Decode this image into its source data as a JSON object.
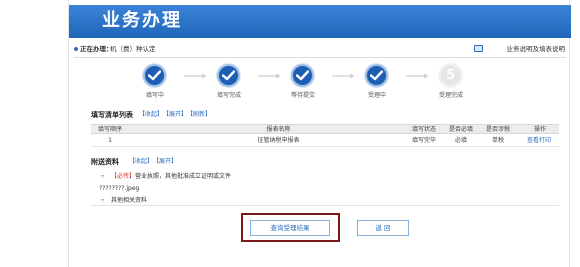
{
  "header": {
    "title": "业务办理"
  },
  "handling": {
    "label": "正在办理：",
    "value": "机（费）种认定",
    "guide_link": "业务说明及填表说明"
  },
  "steps": [
    {
      "label": "填写中",
      "status": "done"
    },
    {
      "label": "填写完成",
      "status": "done"
    },
    {
      "label": "等待提交",
      "status": "done"
    },
    {
      "label": "受理中",
      "status": "done"
    },
    {
      "label": "受理完成",
      "status": "pending",
      "number": "5"
    }
  ],
  "form_list": {
    "title": "填写清单列表",
    "links": [
      "【收起】",
      "【展开】",
      "【刷新】"
    ],
    "columns": [
      "填写顺序",
      "报表名称",
      "填写状态",
      "是否必填",
      "是否涉税",
      "操作"
    ],
    "rows": [
      {
        "order": "1",
        "name": "征管纳税申报表",
        "status": "填写完毕",
        "required": "必填",
        "tax": "单税",
        "action": "查看打印"
      }
    ]
  },
  "attachments": {
    "title": "附送资料",
    "links": [
      "【收起】",
      "【展开】"
    ],
    "items": [
      {
        "expander": "▿",
        "required_tag": "【必传】",
        "text": "营业执照，其他批准成立证明或文件"
      },
      {
        "filename": "????????.jpeg"
      },
      {
        "expander": "▿",
        "text": "其他相关资料"
      }
    ]
  },
  "buttons": {
    "query": "查询受理结果",
    "back": "返 回"
  },
  "colors": {
    "banner": "#2a74c8",
    "accent": "#2c6fc0",
    "highlight_frame": "#7a1a1a",
    "required": "#d9322a"
  }
}
